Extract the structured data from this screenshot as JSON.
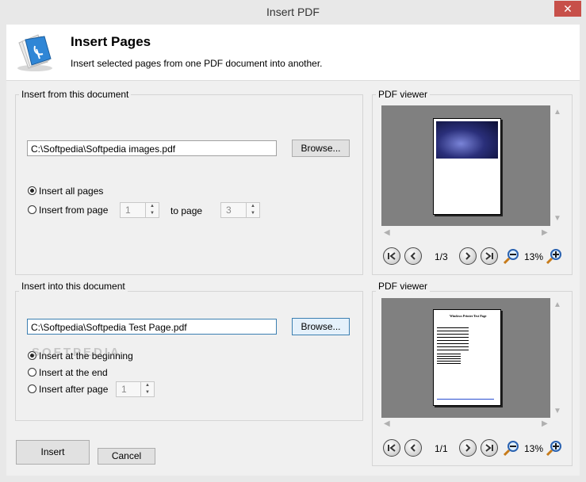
{
  "window": {
    "title": "Insert PDF",
    "close_glyph": "✕"
  },
  "header": {
    "title": "Insert Pages",
    "subtitle": "Insert selected pages from one PDF document into another.",
    "icon": "pdf-pages-icon"
  },
  "source": {
    "legend": "Insert from this document",
    "path": "C:\\Softpedia\\Softpedia images.pdf",
    "browse_label": "Browse...",
    "option_all": "Insert all pages",
    "option_from": "Insert from page",
    "from_value": "1",
    "to_label": "to page",
    "to_value": "3"
  },
  "target": {
    "legend": "Insert into this document",
    "path": "C:\\Softpedia\\Softpedia Test Page.pdf",
    "browse_label": "Browse...",
    "option_beginning": "Insert at the beginning",
    "option_end": "Insert at the end",
    "option_after": "Insert after page",
    "after_value": "1"
  },
  "viewer1": {
    "legend": "PDF viewer",
    "page_info": "1/3",
    "zoom": "13%"
  },
  "viewer2": {
    "legend": "PDF viewer",
    "page_info": "1/1",
    "zoom": "13%",
    "doc_heading": "Windows Printer Test Page"
  },
  "footer": {
    "insert_label": "Insert",
    "cancel_label": "Cancel"
  },
  "watermark": "SOFTPEDIA"
}
